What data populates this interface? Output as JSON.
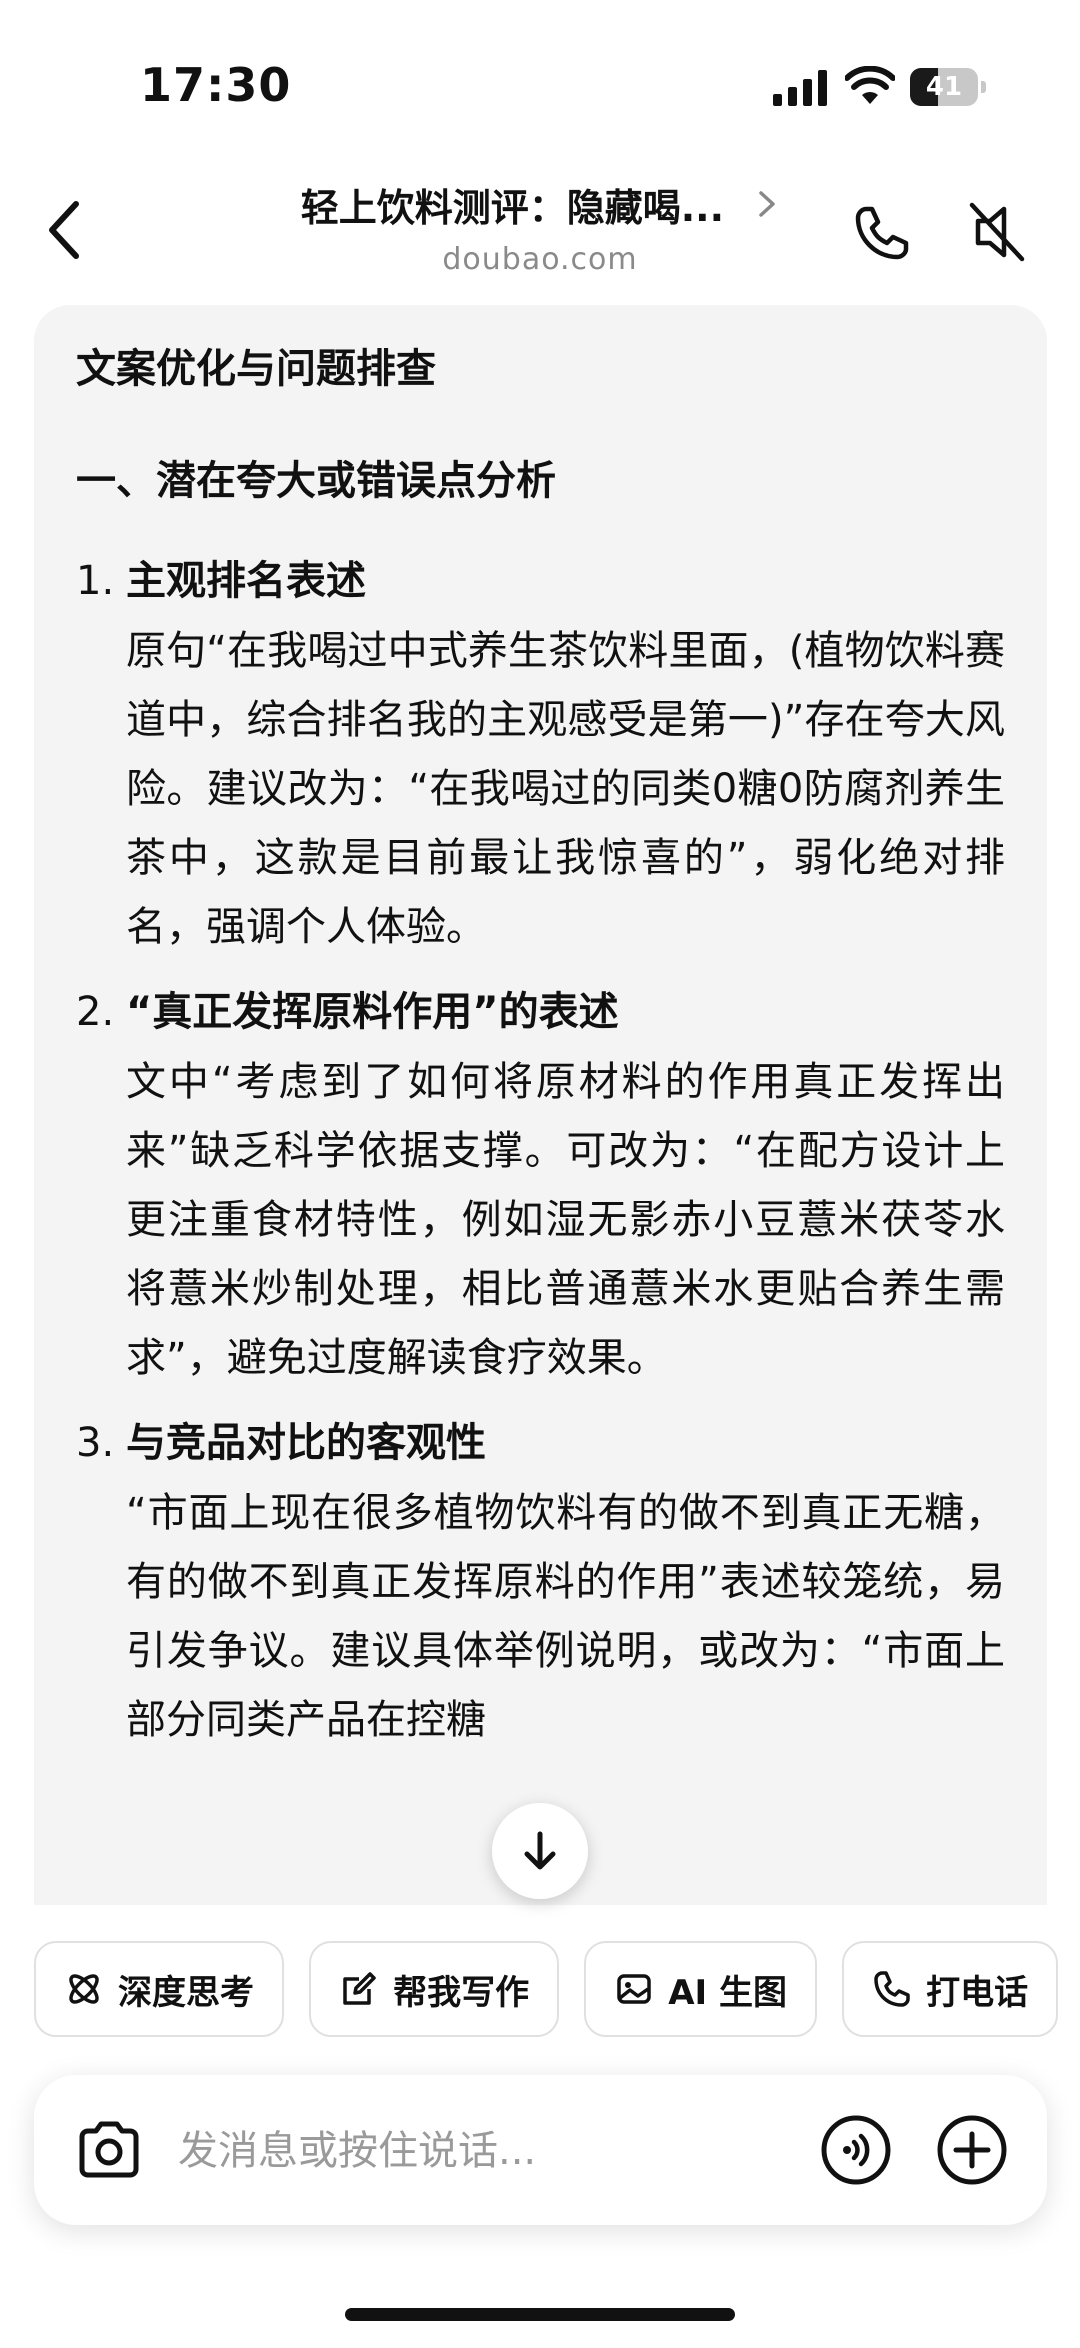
{
  "status_bar": {
    "time": "17:30",
    "battery_level": "41",
    "battery_fraction": 0.41
  },
  "header": {
    "title": "轻上饮料测评：隐藏喝...",
    "subtitle": "doubao.com"
  },
  "message": {
    "title": "文案优化与问题排查",
    "section_heading": "一、潜在夸大或错误点分析",
    "items": [
      {
        "num": "1.",
        "title": "主观排名表述",
        "body": "原句“在我喝过中式养生茶饮料里面，(植物饮料赛道中，综合排名我的主观感受是第一)”存在夸大风险。建议改为：“在我喝过的同类0糖0防腐剂养生茶中，这款是目前最让我惊喜的”，弱化绝对排名，强调个人体验。"
      },
      {
        "num": "2.",
        "title": "“真正发挥原料作用”的表述",
        "body": "文中“考虑到了如何将原材料的作用真正发挥出来”缺乏科学依据支撑。可改为：“在配方设计上更注重食材特性，例如湿无影赤小豆薏米茯苓水将薏米炒制处理，相比普通薏米水更贴合养生需求”，避免过度解读食疗效果。"
      },
      {
        "num": "3.",
        "title": "与竞品对比的客观性",
        "body": "“市面上现在很多植物饮料有的做不到真正无糖，有的做不到真正发挥原料的作用”表述较笼统，易引发争议。建议具体举例说明，或改为：“市面上部分同类产品在控糖"
      }
    ]
  },
  "chips": [
    {
      "label": "深度思考",
      "icon": "deep-think-icon"
    },
    {
      "label": "帮我写作",
      "icon": "edit-icon"
    },
    {
      "label": "AI 生图",
      "icon": "image-icon"
    },
    {
      "label": "打电话",
      "icon": "phone-icon"
    }
  ],
  "input": {
    "placeholder": "发消息或按住说话..."
  }
}
